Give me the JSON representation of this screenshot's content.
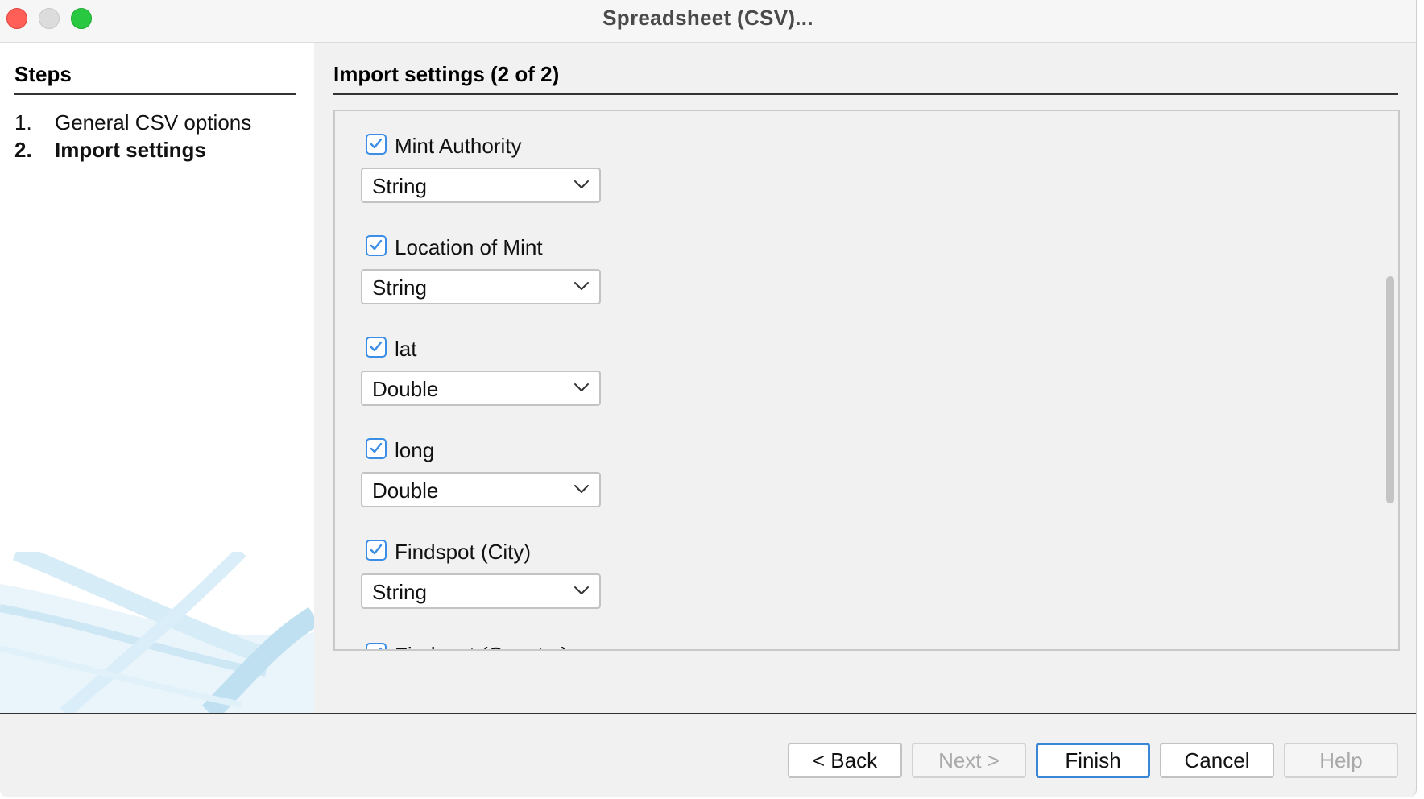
{
  "window": {
    "title": "Spreadsheet (CSV)..."
  },
  "sidebar": {
    "heading": "Steps",
    "steps": [
      {
        "num": "1.",
        "label": "General CSV options"
      },
      {
        "num": "2.",
        "label": "Import settings"
      }
    ]
  },
  "main": {
    "heading": "Import settings (2 of 2)",
    "fields": [
      {
        "label": "Mint Authority",
        "checked": true,
        "type": "String"
      },
      {
        "label": "Location of Mint",
        "checked": true,
        "type": "String"
      },
      {
        "label": "lat",
        "checked": true,
        "type": "Double"
      },
      {
        "label": "long",
        "checked": true,
        "type": "Double"
      },
      {
        "label": "Findspot (City)",
        "checked": true,
        "type": "String"
      },
      {
        "label": "Findspot (Country)",
        "checked": true,
        "type": ""
      }
    ]
  },
  "buttons": {
    "back": "< Back",
    "next": "Next >",
    "finish": "Finish",
    "cancel": "Cancel",
    "help": "Help"
  },
  "colors": {
    "accent": "#3b8ee6",
    "close": "#ff5f57",
    "maximize": "#28c840"
  }
}
